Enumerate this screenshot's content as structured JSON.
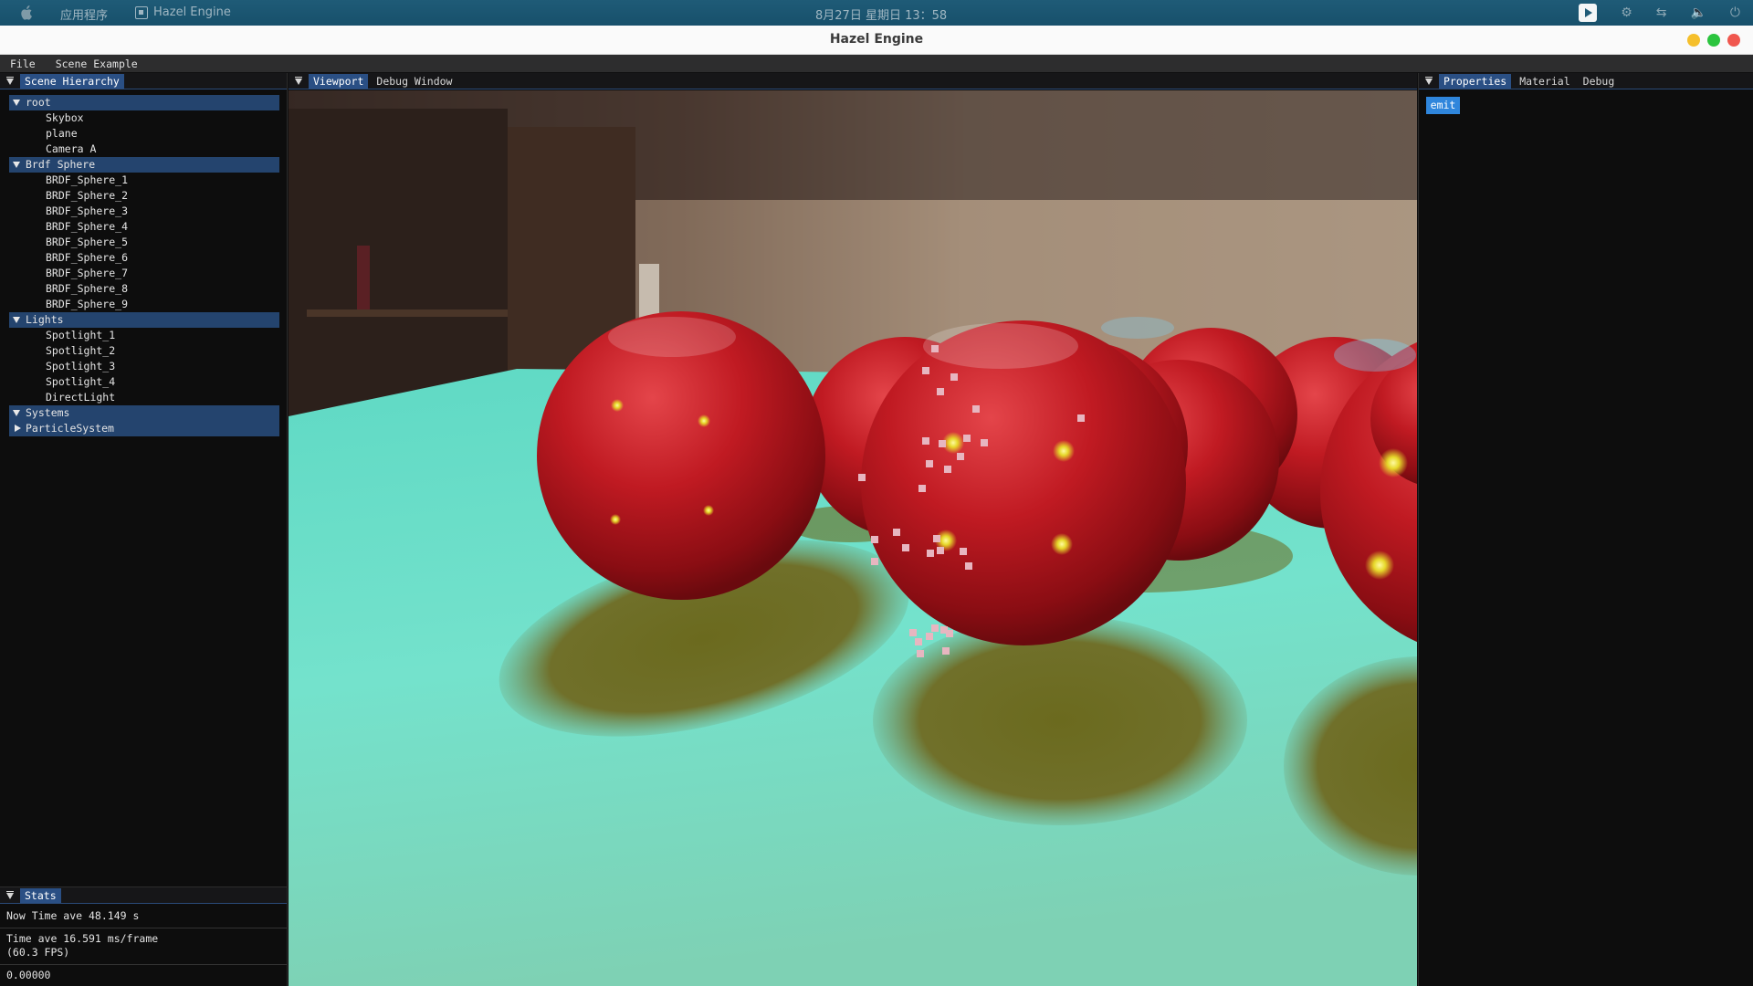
{
  "os_bar": {
    "apps_label": "应用程序",
    "active_app": "Hazel Engine",
    "clock": "8月27日 星期日 13：58"
  },
  "window": {
    "title": "Hazel Engine"
  },
  "menu": [
    "File",
    "Scene Example"
  ],
  "hierarchy": {
    "tab": "Scene Hierarchy",
    "groups": [
      {
        "label": "root",
        "expanded": true,
        "children": [
          "Skybox",
          "plane",
          "Camera A"
        ]
      },
      {
        "label": "Brdf Sphere",
        "expanded": true,
        "children": [
          "BRDF_Sphere_1",
          "BRDF_Sphere_2",
          "BRDF_Sphere_3",
          "BRDF_Sphere_4",
          "BRDF_Sphere_5",
          "BRDF_Sphere_6",
          "BRDF_Sphere_7",
          "BRDF_Sphere_8",
          "BRDF_Sphere_9"
        ]
      },
      {
        "label": "Lights",
        "expanded": true,
        "children": [
          "Spotlight_1",
          "Spotlight_2",
          "Spotlight_3",
          "Spotlight_4",
          "DirectLight"
        ]
      },
      {
        "label": "Systems",
        "expanded": true,
        "children": []
      },
      {
        "label": "ParticleSystem",
        "expanded": false,
        "children": []
      }
    ]
  },
  "stats": {
    "tab": "Stats",
    "now_time": "Now Time ave 48.149 s",
    "frame_time": "Time ave 16.591 ms/frame",
    "fps": "(60.3 FPS)",
    "value": "0.00000"
  },
  "viewport_tabs": [
    "Viewport",
    "Debug Window"
  ],
  "props_tabs": [
    "Properties",
    "Material",
    "Debug"
  ],
  "props": {
    "emit_label": "emit"
  },
  "colors": {
    "accent": "#2a4f84",
    "group_row": "#24446e",
    "emit_button": "#2f86dc",
    "os_bar": "#1f5b77"
  }
}
